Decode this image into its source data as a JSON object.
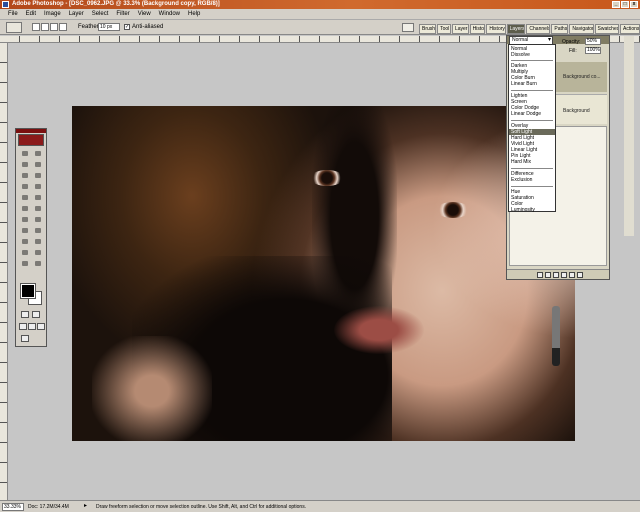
{
  "window": {
    "title": "Adobe Photoshop - [DSC_0962.JPG @ 33.3% (Background copy, RGB/8)]"
  },
  "menubar": {
    "items": [
      "File",
      "Edit",
      "Image",
      "Layer",
      "Select",
      "Filter",
      "View",
      "Window",
      "Help"
    ]
  },
  "options_bar": {
    "feather_label": "Feather:",
    "feather_value": "10 px",
    "antialiased_label": "Anti-aliased",
    "antialiased_checked": true
  },
  "palette_well": {
    "tabs": [
      "Brush",
      "Tool",
      "Layer",
      "Histo",
      "History",
      "Layers",
      "Channels",
      "Paths",
      "Navigator",
      "Swatches",
      "Actions"
    ]
  },
  "layers_panel": {
    "blend_mode": "Normal",
    "opacity_label": "Opacity:",
    "opacity_value": "50%",
    "fill_label": "Fill:",
    "fill_value": "100%",
    "layer_names": [
      "Background co...",
      "Background"
    ]
  },
  "blend_menu": {
    "options": [
      "Normal",
      "Dissolve",
      "Darken",
      "Multiply",
      "Color Burn",
      "Linear Burn",
      "Lighten",
      "Screen",
      "Color Dodge",
      "Linear Dodge",
      "Overlay",
      "Soft Light",
      "Hard Light",
      "Vivid Light",
      "Linear Light",
      "Pin Light",
      "Hard Mix",
      "Difference",
      "Exclusion",
      "Hue",
      "Saturation",
      "Color",
      "Luminosity"
    ],
    "selected": "Soft Light"
  },
  "toolbox": {
    "foreground_color": "#000000",
    "background_color": "#ffffff"
  },
  "statusbar": {
    "zoom": "33.33%",
    "doc_size": "Doc: 17.2M/34.4M",
    "hint": "Draw freeform selection or move selection outline.  Use Shift, Alt, and Ctrl for additional options."
  }
}
